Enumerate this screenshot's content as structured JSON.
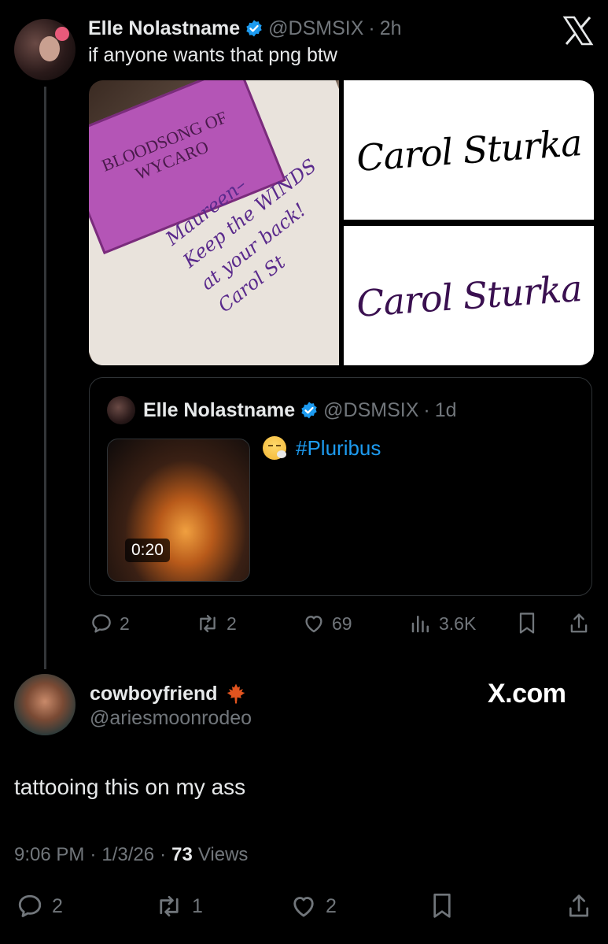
{
  "quoted_tweet": {
    "author_name": "Elle Nolastname",
    "handle": "@DSMSIX",
    "time": "2h",
    "text": "if anyone wants that png btw",
    "images": {
      "book_photo": {
        "book_title_lines": [
          "BLOODSONG OF",
          "WYCARO"
        ],
        "inscription_lines": [
          "Maureen–",
          "Keep the WINDS",
          "at your back!",
          "Carol St"
        ]
      },
      "signature_text": "Carol Sturka"
    },
    "nested_quote": {
      "author_name": "Elle Nolastname",
      "handle": "@DSMSIX",
      "time": "1d",
      "text": "#Pluribus",
      "video_duration": "0:20"
    },
    "actions": {
      "replies": "2",
      "reposts": "2",
      "likes": "69",
      "views": "3.6K"
    }
  },
  "logo_top": "X",
  "reply": {
    "author_name": "cowboyfriend",
    "handle": "@ariesmoonrodeo",
    "text": "tattooing this on my ass",
    "time": "9:06 PM",
    "date": "1/3/26",
    "views_count": "73",
    "views_label": "Views",
    "actions": {
      "replies": "2",
      "reposts": "1",
      "likes": "2"
    }
  },
  "watermark": "X.com",
  "colors": {
    "accent": "#1d9bf0",
    "muted": "#71767b",
    "text": "#e7e9ea",
    "border": "#2f3336"
  }
}
